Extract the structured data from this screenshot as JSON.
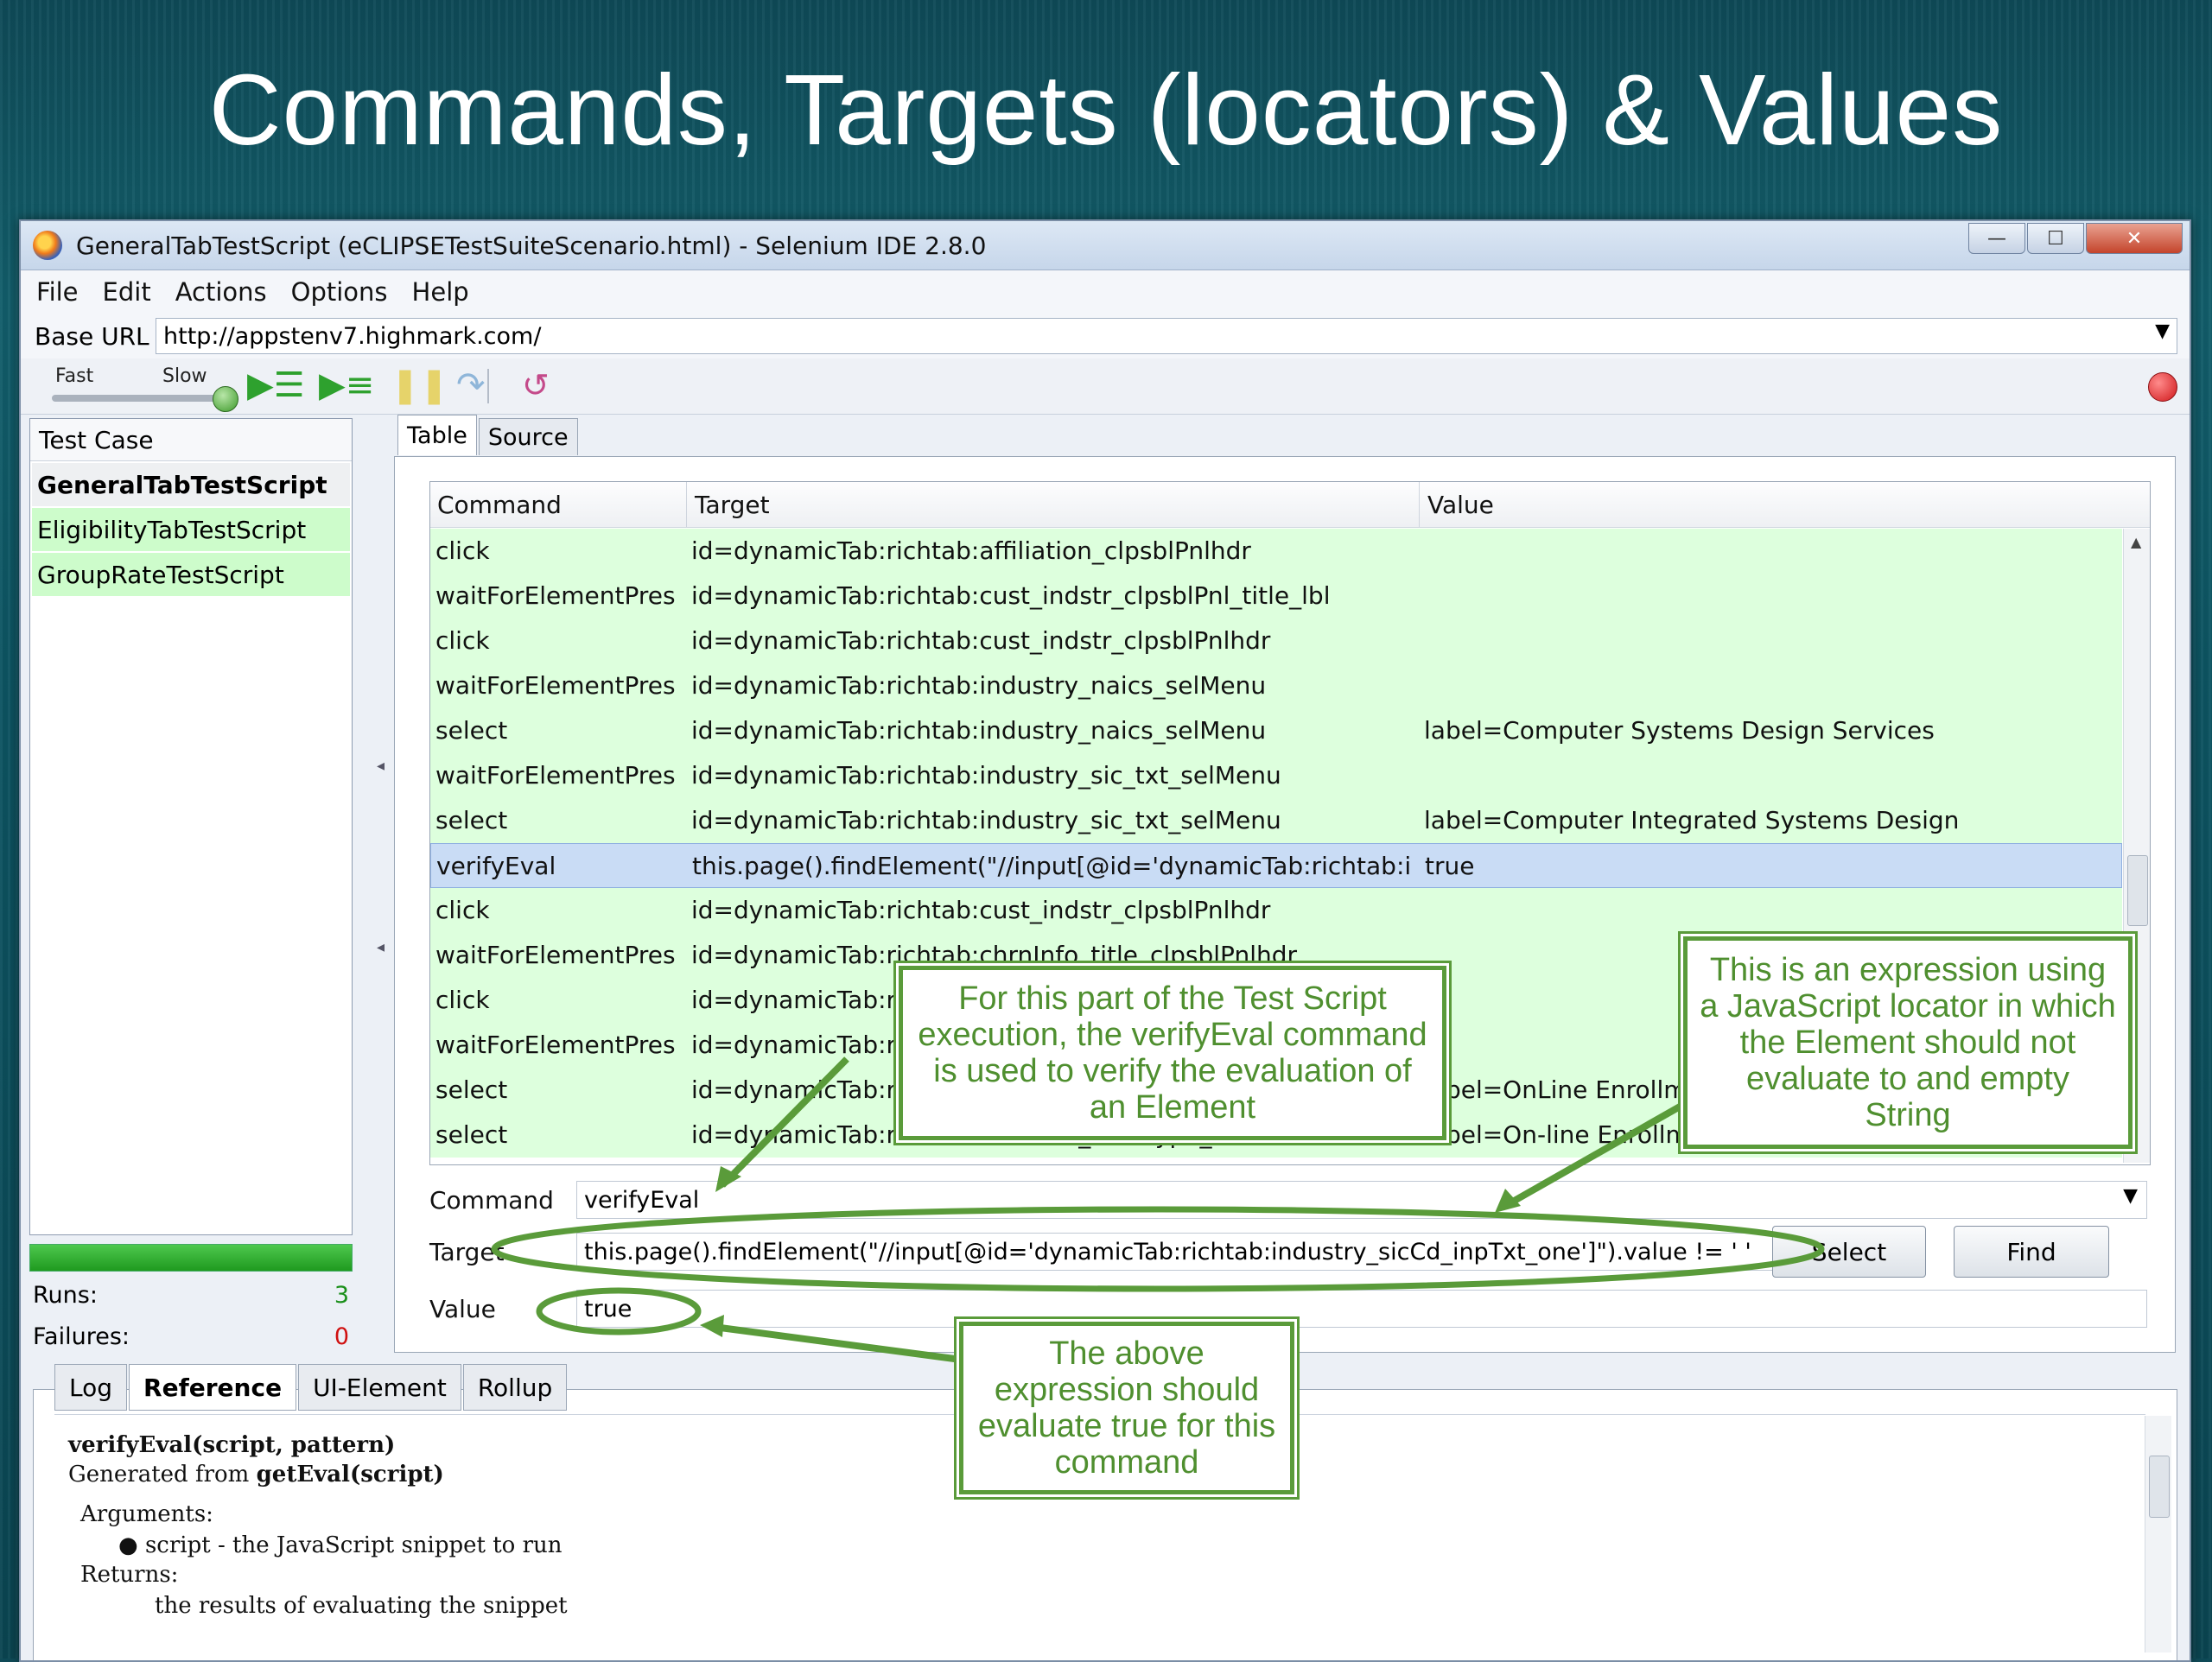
{
  "slide": {
    "title": "Commands, Targets (locators) & Values"
  },
  "window": {
    "title": "GeneralTabTestScript (eCLIPSETestSuiteScenario.html) - Selenium IDE 2.8.0",
    "controls": {
      "minimize": "—",
      "maximize": "☐",
      "close": "✕"
    }
  },
  "menu": [
    "File",
    "Edit",
    "Actions",
    "Options",
    "Help"
  ],
  "base_url": {
    "label": "Base URL",
    "value": "http://appstenv7.highmark.com/"
  },
  "toolbar": {
    "fast": "Fast",
    "slow": "Slow",
    "play_all_icon": "play-all-icon",
    "play_current_icon": "play-current-icon",
    "pause_icon": "pause-icon",
    "step_icon": "step-icon",
    "rollup_icon": "rollup-icon",
    "record_icon": "record-icon"
  },
  "test_cases": {
    "header": "Test Case",
    "items": [
      {
        "name": "GeneralTabTestScript",
        "state": "selected"
      },
      {
        "name": "EligibilityTabTestScript",
        "state": "passed"
      },
      {
        "name": "GroupRateTestScript",
        "state": "passed"
      }
    ],
    "runs_label": "Runs:",
    "runs": "3",
    "failures_label": "Failures:",
    "failures": "0"
  },
  "editor_tabs": [
    "Table",
    "Source"
  ],
  "table": {
    "columns": [
      "Command",
      "Target",
      "Value"
    ],
    "rows": [
      {
        "command": "click",
        "target": "id=dynamicTab:richtab:affiliation_clpsblPnlhdr",
        "value": ""
      },
      {
        "command": "waitForElementPres...",
        "target": "id=dynamicTab:richtab:cust_indstr_clpsblPnl_title_lbl",
        "value": ""
      },
      {
        "command": "click",
        "target": "id=dynamicTab:richtab:cust_indstr_clpsblPnlhdr",
        "value": ""
      },
      {
        "command": "waitForElementPres...",
        "target": "id=dynamicTab:richtab:industry_naics_selMenu",
        "value": ""
      },
      {
        "command": "select",
        "target": "id=dynamicTab:richtab:industry_naics_selMenu",
        "value": "label=Computer Systems Design Services"
      },
      {
        "command": "waitForElementPres...",
        "target": "id=dynamicTab:richtab:industry_sic_txt_selMenu",
        "value": ""
      },
      {
        "command": "select",
        "target": "id=dynamicTab:richtab:industry_sic_txt_selMenu",
        "value": "label=Computer Integrated Systems Design"
      },
      {
        "command": "verifyEval",
        "target": "this.page().findElement(\"//input[@id='dynamicTab:richtab:in...",
        "value": "true",
        "selected": true
      },
      {
        "command": "click",
        "target": "id=dynamicTab:richtab:cust_indstr_clpsblPnlhdr",
        "value": ""
      },
      {
        "command": "waitForElementPres...",
        "target": "id=dynamicTab:richtab:chrnInfo_title_clpsblPnlhdr",
        "value": ""
      },
      {
        "command": "click",
        "target": "id=dynamicTab:richtab:chrnInfo",
        "value": ""
      },
      {
        "command": "waitForElementPres...",
        "target": "id=dynamicTab:richtab:",
        "value": ""
      },
      {
        "command": "select",
        "target": "id=dynamicTab:richtab:",
        "value": "label=OnLine Enrollment"
      },
      {
        "command": "select",
        "target": "id=dynamicTab:richtab:chrnInfo_chrnType_selMenu",
        "value": "label=On-line Enrollment"
      }
    ]
  },
  "fields": {
    "command_label": "Command",
    "command_value": "verifyEval",
    "target_label": "Target",
    "target_value": "this.page().findElement(\"//input[@id='dynamicTab:richtab:industry_sicCd_inpTxt_one']\").value !=  ' '",
    "value_label": "Value",
    "value_value": "true",
    "select_button": "Select",
    "find_button": "Find"
  },
  "bottom_tabs": [
    "Log",
    "Reference",
    "UI-Element",
    "Rollup"
  ],
  "reference": {
    "signature": "verifyEval(script, pattern)",
    "generated_prefix": "Generated from ",
    "generated_from": "getEval(script)",
    "arguments_label": "Arguments:",
    "argument": "script - the JavaScript snippet to run",
    "returns_label": "Returns:",
    "returns": "the results of evaluating the snippet"
  },
  "callouts": {
    "verify": "For this part of the Test Script execution, the verifyEval command is used to verify the evaluation of an Element",
    "expression": "This is an expression using a JavaScript locator in which the Element should not evaluate to and empty String",
    "true_value": "The above expression should evaluate true for this command"
  },
  "colors": {
    "pass_green": "#cdfccb",
    "callout_green": "#5a9b3a",
    "selected_row": "#c9dcf5"
  }
}
